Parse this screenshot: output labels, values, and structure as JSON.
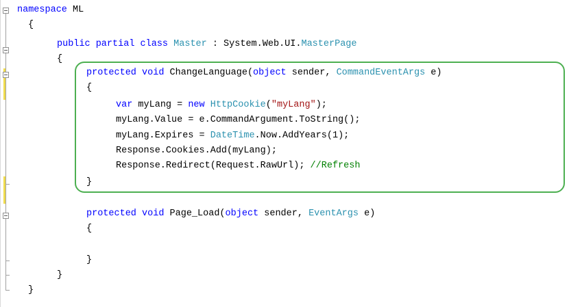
{
  "editor": {
    "lines": {
      "l1": {
        "kw": "namespace",
        "rest": " ML"
      },
      "l2": {
        "brace": "{"
      },
      "l3": {
        "kw1": "public partial class",
        "type": "Master",
        "mid": " : System.Web.UI.",
        "type2": "MasterPage"
      },
      "l4": {
        "brace": "{"
      },
      "l5": {
        "kw1": "protected void",
        "mid": " ChangeLanguage(",
        "kw2": "object",
        "mid2": " sender, ",
        "type": "CommandEventArgs",
        "end": " e)"
      },
      "l6": {
        "brace": "{"
      },
      "l7": {
        "kw": "var",
        "mid": " myLang = ",
        "kw2": "new",
        "type": "HttpCookie",
        "p1": "(",
        "str": "\"myLang\"",
        "p2": ");"
      },
      "l8": {
        "text": "myLang.Value = e.CommandArgument.ToString();"
      },
      "l9": {
        "pre": "myLang.Expires = ",
        "type": "DateTime",
        "post": ".Now.AddYears(1);"
      },
      "l10": {
        "text": "Response.Cookies.Add(myLang);"
      },
      "l11": {
        "pre": "Response.Redirect(Request.RawUrl); ",
        "comment": "//Refresh"
      },
      "l12": {
        "brace": "}"
      },
      "l13": {
        "kw1": "protected void",
        "mid": " Page_Load(",
        "kw2": "object",
        "mid2": " sender, ",
        "type": "EventArgs",
        "end": " e)"
      },
      "l14": {
        "brace": "{"
      },
      "l15": {
        "brace": "}"
      },
      "l16": {
        "brace": "}"
      },
      "l17": {
        "brace": "}"
      }
    },
    "colors": {
      "keyword": "#0000ff",
      "type": "#2b91af",
      "string": "#a31515",
      "comment": "#008000",
      "highlight_border": "#4caf50",
      "change_marker": "#f0dc4e"
    }
  }
}
